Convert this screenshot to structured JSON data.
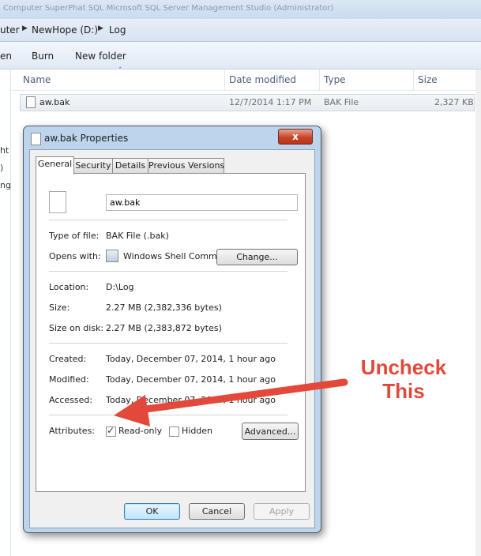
{
  "explorer": {
    "title_text": "Computer  SuperPhat  SQL  Microsoft SQL Server Management Studio (Administrator)",
    "breadcrumb": [
      "uter",
      "NewHope (D:)",
      "Log"
    ],
    "commands": [
      "en",
      "Burn",
      "New folder"
    ],
    "nav_fragments": [
      "ht",
      ")",
      "ng"
    ],
    "columns": [
      "Name",
      "Date modified",
      "Type",
      "Size"
    ],
    "file": {
      "name": "aw.bak",
      "date": "12/7/2014 1:17 PM",
      "type": "BAK File",
      "size": "2,327 KB"
    }
  },
  "dialog": {
    "title": "aw.bak Properties",
    "close_label": "x",
    "tabs": [
      "General",
      "Security",
      "Details",
      "Previous Versions"
    ],
    "filename": "aw.bak",
    "rows": {
      "type_label": "Type of file:",
      "type_value": "BAK File (.bak)",
      "opens_label": "Opens with:",
      "opens_value": "Windows Shell Commor",
      "change_label": "Change...",
      "location_label": "Location:",
      "location_value": "D:\\Log",
      "size_label": "Size:",
      "size_value": "2.27 MB (2,382,336 bytes)",
      "sizeondisk_label": "Size on disk:",
      "sizeondisk_value": "2.27 MB (2,383,872 bytes)",
      "created_label": "Created:",
      "created_value": "Today, December 07, 2014, 1 hour ago",
      "modified_label": "Modified:",
      "modified_value": "Today, December 07, 2014, 1 hour ago",
      "accessed_label": "Accessed:",
      "accessed_value": "Today, December 07, 2014, 1 hour ago",
      "attributes_label": "Attributes:",
      "readonly_label": "Read-only",
      "readonly_checked": true,
      "hidden_label": "Hidden",
      "hidden_checked": false,
      "advanced_label": "Advanced..."
    },
    "buttons": {
      "ok": "OK",
      "cancel": "Cancel",
      "apply": "Apply"
    }
  },
  "annotation": {
    "line1": "Uncheck",
    "line2": "This",
    "color": "#e2493a"
  }
}
